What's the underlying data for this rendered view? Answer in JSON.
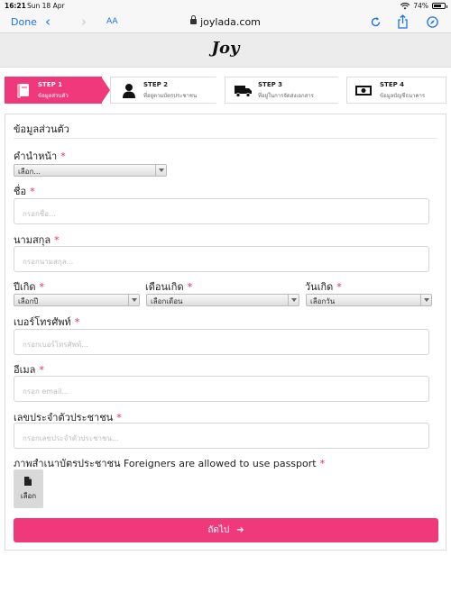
{
  "status_bar": {
    "time": "16:21",
    "date": "Sun 18 Apr",
    "battery": "74%",
    "battery_level": 0.74
  },
  "browser": {
    "done_label": "Done",
    "text_size_label": "AA",
    "url": "joylada.com",
    "icons": [
      "chevron-left-icon",
      "chevron-right-icon",
      "reload-icon",
      "share-icon",
      "compass-icon"
    ]
  },
  "site": {
    "logo_text": "Joy"
  },
  "steps": [
    {
      "title": "STEP 1",
      "subtitle": "ข้อมูลส่วนตัว",
      "icon": "book-icon",
      "active": true
    },
    {
      "title": "STEP 2",
      "subtitle": "ที่อยู่ตามบัตรประชาชน",
      "icon": "person-icon",
      "active": false
    },
    {
      "title": "STEP 3",
      "subtitle": "ที่อยู่ในการจัดส่งเอกสาร",
      "icon": "truck-icon",
      "active": false
    },
    {
      "title": "STEP 4",
      "subtitle": "ข้อมูลบัญชีธนาคาร",
      "icon": "banknote-icon",
      "active": false
    }
  ],
  "form": {
    "heading": "ข้อมูลส่วนตัว",
    "required_marker": "*",
    "title_label": "คำนำหน้า",
    "title_select": "เลือก...",
    "first_name_label": "ชื่อ",
    "first_name_placeholder": "กรอกชื่อ...",
    "last_name_label": "นามสกุล",
    "last_name_placeholder": "กรอกนามสกุล...",
    "birth_year_label": "ปีเกิด",
    "birth_year_select": "เลือกปี",
    "birth_month_label": "เดือนเกิด",
    "birth_month_select": "เลือกเดือน",
    "birth_day_label": "วันเกิด",
    "birth_day_select": "เลือกวัน",
    "phone_label": "เบอร์โทรศัพท์",
    "phone_placeholder": "กรอกเบอร์โทรศัพท์...",
    "email_label": "อีเมล",
    "email_placeholder": "กรอก email...",
    "id_label": "เลขประจำตัวประชาชน",
    "id_placeholder": "กรอกเลขประจำตัวประชาชน...",
    "id_photo_label": "ภาพสำเนาบัตรประชาชน Foreigners are allowed to use passport",
    "upload_label": "เลือก",
    "next_label": "ถัดไป"
  },
  "colors": {
    "accent": "#f0397a",
    "link": "#1a73e8",
    "required": "#e8285f"
  }
}
